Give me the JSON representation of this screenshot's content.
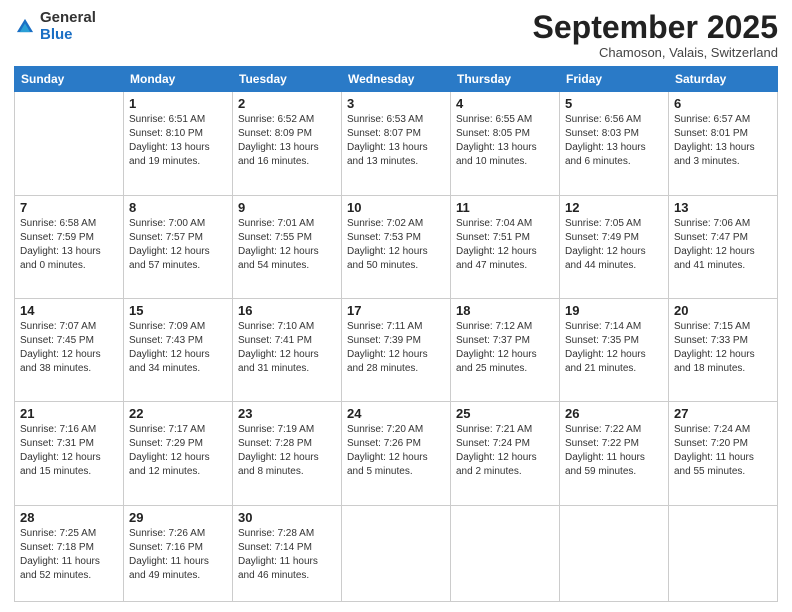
{
  "logo": {
    "general": "General",
    "blue": "Blue"
  },
  "header": {
    "month": "September 2025",
    "location": "Chamoson, Valais, Switzerland"
  },
  "weekdays": [
    "Sunday",
    "Monday",
    "Tuesday",
    "Wednesday",
    "Thursday",
    "Friday",
    "Saturday"
  ],
  "weeks": [
    [
      {
        "day": "",
        "info": ""
      },
      {
        "day": "1",
        "info": "Sunrise: 6:51 AM\nSunset: 8:10 PM\nDaylight: 13 hours\nand 19 minutes."
      },
      {
        "day": "2",
        "info": "Sunrise: 6:52 AM\nSunset: 8:09 PM\nDaylight: 13 hours\nand 16 minutes."
      },
      {
        "day": "3",
        "info": "Sunrise: 6:53 AM\nSunset: 8:07 PM\nDaylight: 13 hours\nand 13 minutes."
      },
      {
        "day": "4",
        "info": "Sunrise: 6:55 AM\nSunset: 8:05 PM\nDaylight: 13 hours\nand 10 minutes."
      },
      {
        "day": "5",
        "info": "Sunrise: 6:56 AM\nSunset: 8:03 PM\nDaylight: 13 hours\nand 6 minutes."
      },
      {
        "day": "6",
        "info": "Sunrise: 6:57 AM\nSunset: 8:01 PM\nDaylight: 13 hours\nand 3 minutes."
      }
    ],
    [
      {
        "day": "7",
        "info": "Sunrise: 6:58 AM\nSunset: 7:59 PM\nDaylight: 13 hours\nand 0 minutes."
      },
      {
        "day": "8",
        "info": "Sunrise: 7:00 AM\nSunset: 7:57 PM\nDaylight: 12 hours\nand 57 minutes."
      },
      {
        "day": "9",
        "info": "Sunrise: 7:01 AM\nSunset: 7:55 PM\nDaylight: 12 hours\nand 54 minutes."
      },
      {
        "day": "10",
        "info": "Sunrise: 7:02 AM\nSunset: 7:53 PM\nDaylight: 12 hours\nand 50 minutes."
      },
      {
        "day": "11",
        "info": "Sunrise: 7:04 AM\nSunset: 7:51 PM\nDaylight: 12 hours\nand 47 minutes."
      },
      {
        "day": "12",
        "info": "Sunrise: 7:05 AM\nSunset: 7:49 PM\nDaylight: 12 hours\nand 44 minutes."
      },
      {
        "day": "13",
        "info": "Sunrise: 7:06 AM\nSunset: 7:47 PM\nDaylight: 12 hours\nand 41 minutes."
      }
    ],
    [
      {
        "day": "14",
        "info": "Sunrise: 7:07 AM\nSunset: 7:45 PM\nDaylight: 12 hours\nand 38 minutes."
      },
      {
        "day": "15",
        "info": "Sunrise: 7:09 AM\nSunset: 7:43 PM\nDaylight: 12 hours\nand 34 minutes."
      },
      {
        "day": "16",
        "info": "Sunrise: 7:10 AM\nSunset: 7:41 PM\nDaylight: 12 hours\nand 31 minutes."
      },
      {
        "day": "17",
        "info": "Sunrise: 7:11 AM\nSunset: 7:39 PM\nDaylight: 12 hours\nand 28 minutes."
      },
      {
        "day": "18",
        "info": "Sunrise: 7:12 AM\nSunset: 7:37 PM\nDaylight: 12 hours\nand 25 minutes."
      },
      {
        "day": "19",
        "info": "Sunrise: 7:14 AM\nSunset: 7:35 PM\nDaylight: 12 hours\nand 21 minutes."
      },
      {
        "day": "20",
        "info": "Sunrise: 7:15 AM\nSunset: 7:33 PM\nDaylight: 12 hours\nand 18 minutes."
      }
    ],
    [
      {
        "day": "21",
        "info": "Sunrise: 7:16 AM\nSunset: 7:31 PM\nDaylight: 12 hours\nand 15 minutes."
      },
      {
        "day": "22",
        "info": "Sunrise: 7:17 AM\nSunset: 7:29 PM\nDaylight: 12 hours\nand 12 minutes."
      },
      {
        "day": "23",
        "info": "Sunrise: 7:19 AM\nSunset: 7:28 PM\nDaylight: 12 hours\nand 8 minutes."
      },
      {
        "day": "24",
        "info": "Sunrise: 7:20 AM\nSunset: 7:26 PM\nDaylight: 12 hours\nand 5 minutes."
      },
      {
        "day": "25",
        "info": "Sunrise: 7:21 AM\nSunset: 7:24 PM\nDaylight: 12 hours\nand 2 minutes."
      },
      {
        "day": "26",
        "info": "Sunrise: 7:22 AM\nSunset: 7:22 PM\nDaylight: 11 hours\nand 59 minutes."
      },
      {
        "day": "27",
        "info": "Sunrise: 7:24 AM\nSunset: 7:20 PM\nDaylight: 11 hours\nand 55 minutes."
      }
    ],
    [
      {
        "day": "28",
        "info": "Sunrise: 7:25 AM\nSunset: 7:18 PM\nDaylight: 11 hours\nand 52 minutes."
      },
      {
        "day": "29",
        "info": "Sunrise: 7:26 AM\nSunset: 7:16 PM\nDaylight: 11 hours\nand 49 minutes."
      },
      {
        "day": "30",
        "info": "Sunrise: 7:28 AM\nSunset: 7:14 PM\nDaylight: 11 hours\nand 46 minutes."
      },
      {
        "day": "",
        "info": ""
      },
      {
        "day": "",
        "info": ""
      },
      {
        "day": "",
        "info": ""
      },
      {
        "day": "",
        "info": ""
      }
    ]
  ]
}
